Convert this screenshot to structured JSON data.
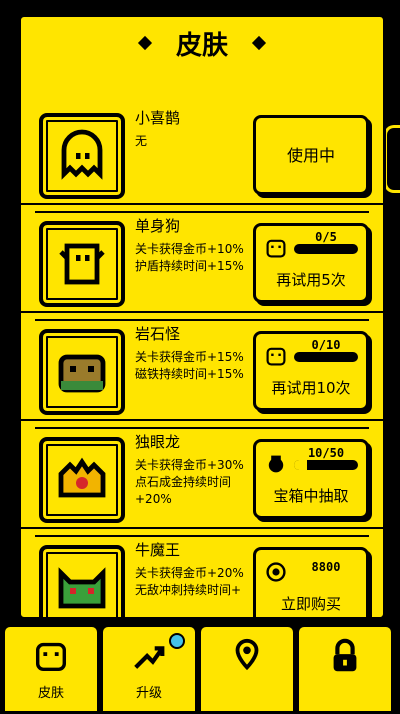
{
  "header": {
    "title": "皮肤"
  },
  "skins": [
    {
      "name": "小喜鹊",
      "desc": "无",
      "action": "使用中",
      "icon": "ghost-icon"
    },
    {
      "name": "单身狗",
      "desc": "关卡获得金币+10%\n护盾持续时间+15%",
      "action": "再试用5次",
      "progress_text": "0/5",
      "progress": 0,
      "icon": "dog-icon"
    },
    {
      "name": "岩石怪",
      "desc": "关卡获得金币+15%\n磁铁持续时间+15%",
      "action": "再试用10次",
      "progress_text": "0/10",
      "progress": 0,
      "icon": "rock-monster-icon"
    },
    {
      "name": "独眼龙",
      "desc": "关卡获得金币+30%\n点石成金持续时间+20%",
      "action": "宝箱中抽取",
      "progress_text": "10/50",
      "progress": 0.2,
      "icon": "one-eyed-dragon-icon"
    },
    {
      "name": "牛魔王",
      "desc": "关卡获得金币+20%\n无敌冲刺持续时间+",
      "action": "立即购买",
      "price": "8800",
      "icon": "bull-king-icon"
    }
  ],
  "nav": [
    {
      "label": "皮肤",
      "icon": "robot-icon",
      "active": true
    },
    {
      "label": "升级",
      "icon": "upgrade-arrow-icon",
      "badge": true
    },
    {
      "label": "",
      "icon": "map-pin-icon"
    },
    {
      "label": "",
      "icon": "lock-icon"
    }
  ],
  "colors": {
    "accent": "#ffe500",
    "dark": "#000000",
    "badge": "#45c1e8"
  }
}
